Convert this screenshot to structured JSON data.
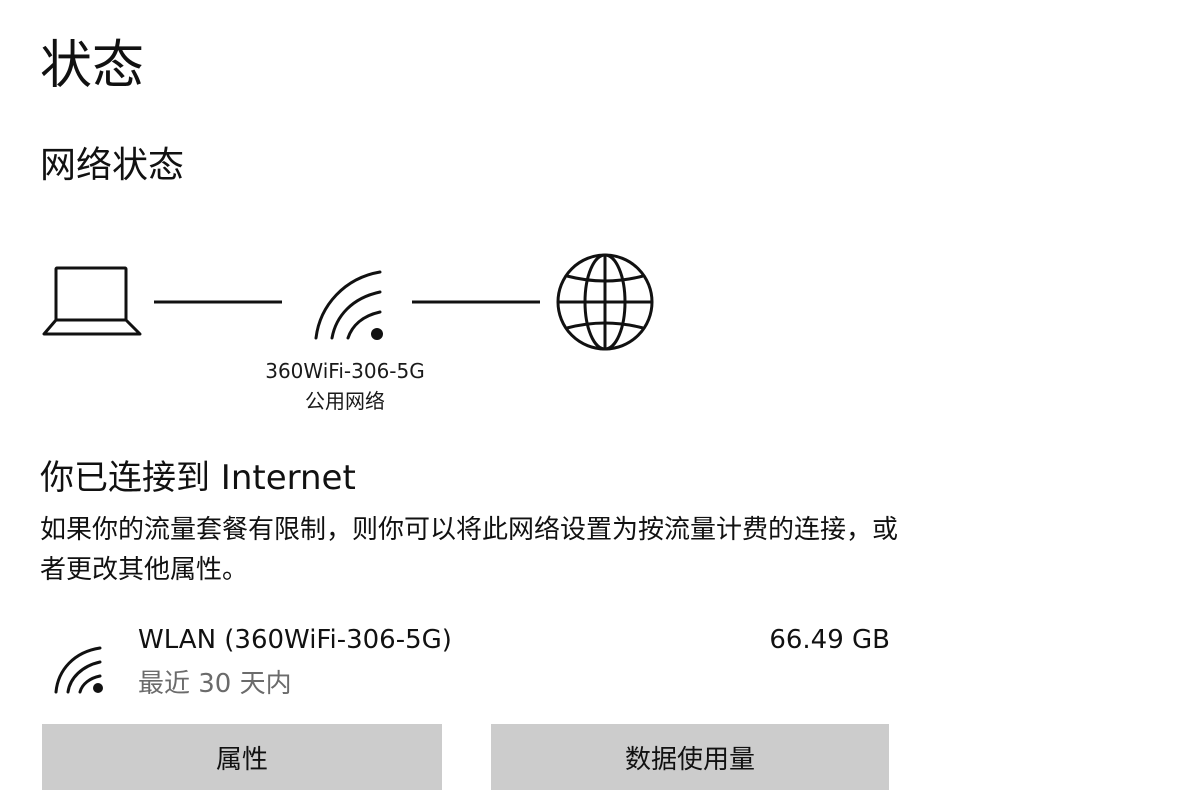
{
  "page": {
    "title": "状态"
  },
  "network_status": {
    "heading": "网络状态",
    "diagram": {
      "left_icon": "laptop-icon",
      "middle_icon": "wifi-signal-icon",
      "right_icon": "globe-icon",
      "network_name": "360WiFi-306-5G",
      "network_type": "公用网络"
    }
  },
  "connection": {
    "title": "你已连接到 Internet",
    "description": "如果你的流量套餐有限制，则你可以将此网络设置为按流量计费的连接，或者更改其他属性。"
  },
  "usage": {
    "icon": "wifi-signal-icon",
    "adapter": "WLAN (360WiFi-306-5G)",
    "period": "最近 30 天内",
    "amount": "66.49 GB"
  },
  "buttons": {
    "properties": "属性",
    "data_usage": "数据使用量"
  },
  "colors": {
    "background": "#ffffff",
    "text": "#111111",
    "secondary_text": "#6b6b6b",
    "button_bg": "#cccccc"
  }
}
